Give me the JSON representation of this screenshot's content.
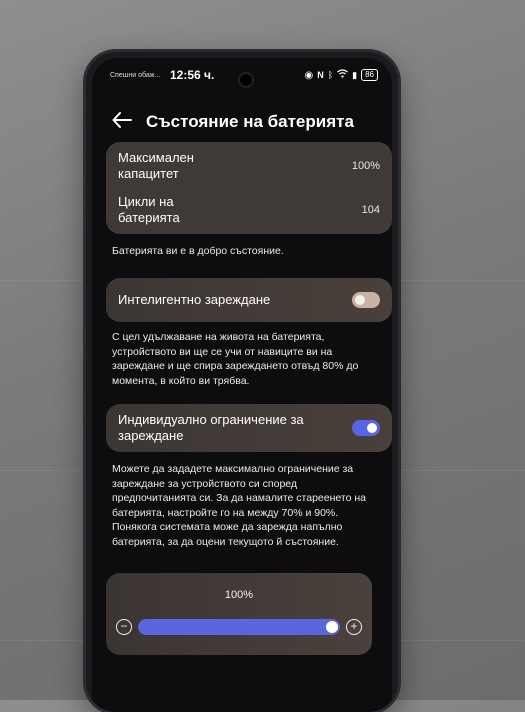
{
  "status_bar": {
    "carrier": "Спешни обаж...",
    "time": "12:56 ч.",
    "battery_level": "86",
    "icons": [
      "eye-icon",
      "nfc-icon",
      "bluetooth-icon",
      "wifi-icon",
      "battery-saver-icon"
    ]
  },
  "header": {
    "back_icon": "back-arrow-icon",
    "title": "Състояние на батерията"
  },
  "battery_info": {
    "max_capacity_label": "Максимален капацитет",
    "max_capacity_value": "100%",
    "cycles_label": "Цикли на батерията",
    "cycles_value": "104",
    "health_note": "Батерията ви е в добро състояние."
  },
  "smart_charging": {
    "label": "Интелигентно зареждане",
    "enabled": false,
    "description": "С цел удължаване на живота на батерията, устройството ви ще се учи от навиците ви на зареждане и ще спира зареждането отвъд 80% до момента, в който ви трябва."
  },
  "custom_limit": {
    "label": "Индивидуално ограничение за зареждане",
    "enabled": true,
    "description": "Можете да зададете максимално ограничение за зареждане за устройството си според предпочитанията си. За да намалите стареенето на батерията, настройте го на между 70% и 90%. Понякога системата може да зарежда напълно батерията, за да оцени текущото й състояние."
  },
  "limit_slider": {
    "value_label": "100%",
    "value": 100,
    "min": 0,
    "max": 100
  },
  "colors": {
    "accent": "#5865e5",
    "card": "#3f3a38",
    "background": "#0d0d0f"
  }
}
